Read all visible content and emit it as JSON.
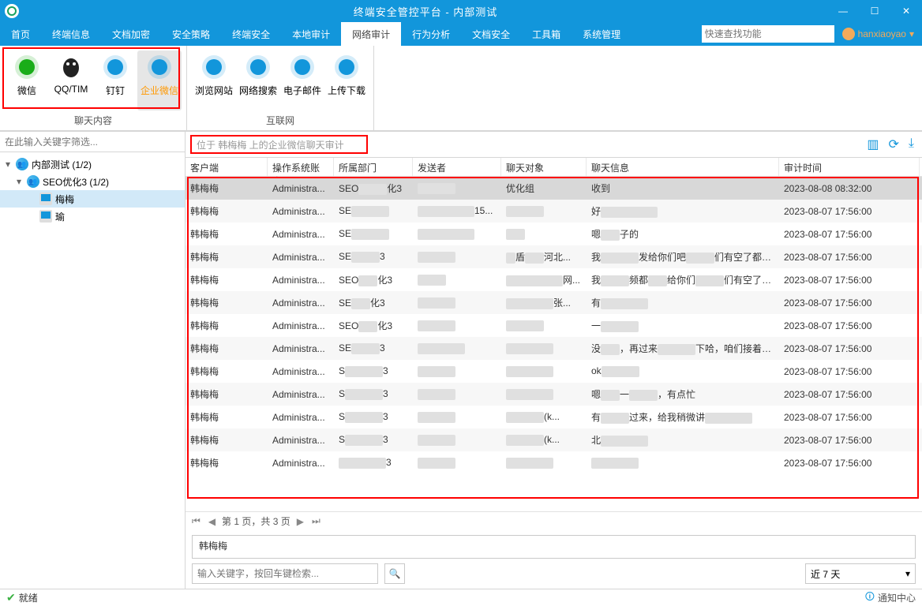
{
  "window": {
    "title": "终端安全管控平台 - 内部测试"
  },
  "menubar": {
    "tabs": [
      "首页",
      "终端信息",
      "文档加密",
      "安全策略",
      "终端安全",
      "本地审计",
      "网络审计",
      "行为分析",
      "文档安全",
      "工具箱",
      "系统管理"
    ],
    "active_index": 6,
    "search_placeholder": "快速查找功能",
    "user": "hanxiaoyao"
  },
  "toolbar": {
    "groups": [
      {
        "label": "聊天内容",
        "items": [
          {
            "name": "微信",
            "color": "#1aad19",
            "icon": "wechat",
            "active": false
          },
          {
            "name": "QQ/TIM",
            "color": "#e6162d",
            "icon": "qq",
            "active": false
          },
          {
            "name": "钉钉",
            "color": "#1296db",
            "icon": "ding",
            "active": false
          },
          {
            "name": "企业微信",
            "color": "#1296db",
            "icon": "wework",
            "active": true
          }
        ]
      },
      {
        "label": "互联网",
        "items": [
          {
            "name": "浏览网站",
            "color": "#1296db",
            "icon": "globe"
          },
          {
            "name": "网络搜索",
            "color": "#1296db",
            "icon": "search"
          },
          {
            "name": "电子邮件",
            "color": "#1296db",
            "icon": "mail"
          },
          {
            "name": "上传下载",
            "color": "#1296db",
            "icon": "cloud"
          }
        ]
      }
    ]
  },
  "sidebar": {
    "filter_placeholder": "在此输入关键字筛选...",
    "nodes": [
      {
        "label": "内部测试 (1/2)",
        "type": "group",
        "indent": 0,
        "arrow": "▾"
      },
      {
        "label": "SEO优化3 (1/2)",
        "type": "group",
        "indent": 1,
        "arrow": "▾"
      },
      {
        "label": "    梅梅",
        "type": "host",
        "indent": 2,
        "selected": true
      },
      {
        "label": "        瑜",
        "type": "host",
        "indent": 2
      }
    ]
  },
  "crumb": {
    "text": "位于 韩梅梅 上的企业微信聊天审计"
  },
  "grid": {
    "columns": [
      "客户端",
      "操作系统账户",
      "所属部门",
      "发送者",
      "聊天对象",
      "聊天信息",
      "审计时间"
    ],
    "rows": [
      {
        "c0": "韩梅梅",
        "c1": "Administra...",
        "c2": "SEO      化3",
        "c3": "        ",
        "c4": "优化组",
        "c5": "收到",
        "c6": "2023-08-08 08:32:00",
        "sel": true
      },
      {
        "c0": "韩梅梅",
        "c1": "Administra...",
        "c2": "SE        ",
        "c3": "            15...",
        "c4": "        ",
        "c5": "好            ",
        "c6": "2023-08-07 17:56:00"
      },
      {
        "c0": "韩梅梅",
        "c1": "Administra...",
        "c2": "SE        ",
        "c3": "            ",
        "c4": "    ",
        "c5": "嗯    子的",
        "c6": "2023-08-07 17:56:00"
      },
      {
        "c0": "韩梅梅",
        "c1": "Administra...",
        "c2": "SE      3",
        "c3": "        ",
        "c4": "  盾    河北...",
        "c5": "我        发给你们吧      们有空了都看...",
        "c6": "2023-08-07 17:56:00"
      },
      {
        "c0": "韩梅梅",
        "c1": "Administra...",
        "c2": "SEO    化3",
        "c3": "      ",
        "c4": "            网...",
        "c5": "我      频都    给你们      们有空了都看...",
        "c6": "2023-08-07 17:56:00"
      },
      {
        "c0": "韩梅梅",
        "c1": "Administra...",
        "c2": "SE    化3",
        "c3": "        ",
        "c4": "          张...",
        "c5": "有          ",
        "c6": "2023-08-07 17:56:00"
      },
      {
        "c0": "韩梅梅",
        "c1": "Administra...",
        "c2": "SEO    化3",
        "c3": "        ",
        "c4": "        ",
        "c5": "一        ",
        "c6": "2023-08-07 17:56:00"
      },
      {
        "c0": "韩梅梅",
        "c1": "Administra...",
        "c2": "SE      3",
        "c3": "          ",
        "c4": "          ",
        "c5": "没    ，再过来        下哈，咱们接着沟通...",
        "c6": "2023-08-07 17:56:00"
      },
      {
        "c0": "韩梅梅",
        "c1": "Administra...",
        "c2": "S        3",
        "c3": "        ",
        "c4": "          ",
        "c5": "ok        ",
        "c6": "2023-08-07 17:56:00"
      },
      {
        "c0": "韩梅梅",
        "c1": "Administra...",
        "c2": "S        3",
        "c3": "        ",
        "c4": "          ",
        "c5": "嗯    一      ，有点忙",
        "c6": "2023-08-07 17:56:00"
      },
      {
        "c0": "韩梅梅",
        "c1": "Administra...",
        "c2": "S        3",
        "c3": "        ",
        "c4": "        (k...",
        "c5": "有      过来，给我稍微讲          ",
        "c6": "2023-08-07 17:56:00"
      },
      {
        "c0": "韩梅梅",
        "c1": "Administra...",
        "c2": "S        3",
        "c3": "        ",
        "c4": "        (k...",
        "c5": "北          ",
        "c6": "2023-08-07 17:56:00"
      },
      {
        "c0": "韩梅梅",
        "c1": "Administra...",
        "c2": "          3",
        "c3": "        ",
        "c4": "          ",
        "c5": "          ",
        "c6": "2023-08-07 17:56:00"
      }
    ],
    "pager_label": "第 1 页，共 3 页"
  },
  "detail": {
    "name": "韩梅梅"
  },
  "bottom": {
    "keyword_placeholder": "输入关键字，按回车键检索...",
    "range_label": "近 7 天"
  },
  "statusbar": {
    "ready": "就绪",
    "notify": "通知中心"
  }
}
